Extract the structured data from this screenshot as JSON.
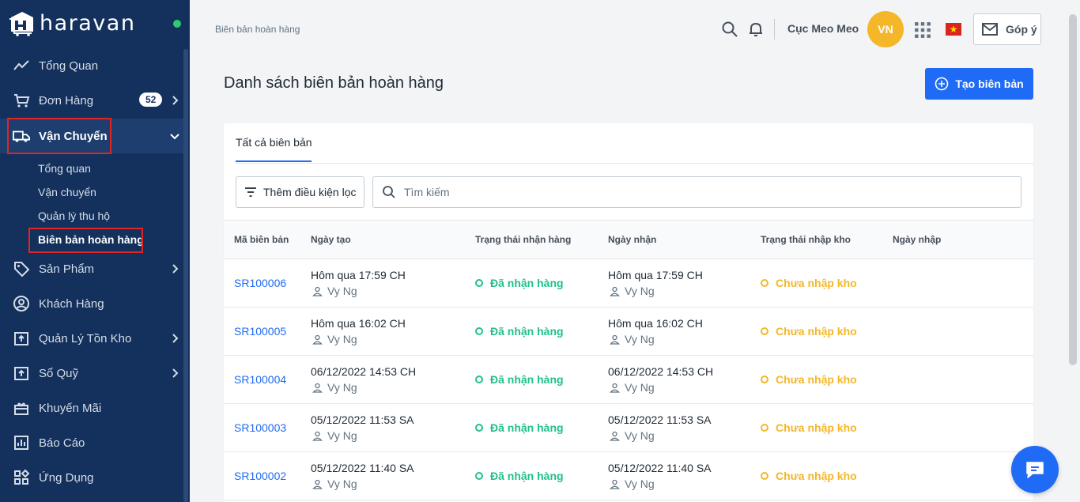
{
  "sidebar": {
    "brand": "haravan",
    "items": [
      {
        "label": "Tổng Quan"
      },
      {
        "label": "Đơn Hàng",
        "badge": "52"
      },
      {
        "label": "Vận Chuyển"
      },
      {
        "label": "Sản Phẩm"
      },
      {
        "label": "Khách Hàng"
      },
      {
        "label": "Quản Lý Tồn Kho"
      },
      {
        "label": "Sổ Quỹ"
      },
      {
        "label": "Khuyến Mãi"
      },
      {
        "label": "Báo Cáo"
      },
      {
        "label": "Ứng Dụng"
      }
    ],
    "sub_items": [
      {
        "label": "Tổng quan"
      },
      {
        "label": "Vận chuyển"
      },
      {
        "label": "Quản lý thu hộ"
      },
      {
        "label": "Biên bản hoàn hàng"
      }
    ]
  },
  "topbar": {
    "breadcrumb": "Biên bản hoàn hàng",
    "shop_name": "Cục Meo Meo",
    "avatar_initials": "VN",
    "feedback_label": "Góp ý"
  },
  "page": {
    "title": "Danh sách biên bản hoàn hàng",
    "create_button": "Tạo biên bản",
    "tab": "Tất cả biên bản",
    "filter_button": "Thêm điều kiện lọc",
    "search_placeholder": "Tìm kiếm"
  },
  "table": {
    "columns": [
      "Mã biên bản",
      "Ngày tạo",
      "Trạng thái nhận hàng",
      "Ngày nhận",
      "Trạng thái nhập kho",
      "Ngày nhập"
    ],
    "rows": [
      {
        "code": "SR100006",
        "created": "Hôm qua 17:59 CH",
        "creator": "Vy Ng",
        "receive_status": "Đã nhận hàng",
        "received": "Hôm qua 17:59 CH",
        "receiver": "Vy Ng",
        "stock_status": "Chưa nhập kho",
        "stocked": ""
      },
      {
        "code": "SR100005",
        "created": "Hôm qua 16:02 CH",
        "creator": "Vy Ng",
        "receive_status": "Đã nhận hàng",
        "received": "Hôm qua 16:02 CH",
        "receiver": "Vy Ng",
        "stock_status": "Chưa nhập kho",
        "stocked": ""
      },
      {
        "code": "SR100004",
        "created": "06/12/2022 14:53 CH",
        "creator": "Vy Ng",
        "receive_status": "Đã nhận hàng",
        "received": "06/12/2022 14:53 CH",
        "receiver": "Vy Ng",
        "stock_status": "Chưa nhập kho",
        "stocked": ""
      },
      {
        "code": "SR100003",
        "created": "05/12/2022 11:53 SA",
        "creator": "Vy Ng",
        "receive_status": "Đã nhận hàng",
        "received": "05/12/2022 11:53 SA",
        "receiver": "Vy Ng",
        "stock_status": "Chưa nhập kho",
        "stocked": ""
      },
      {
        "code": "SR100002",
        "created": "05/12/2022 11:40 SA",
        "creator": "Vy Ng",
        "receive_status": "Đã nhận hàng",
        "received": "05/12/2022 11:40 SA",
        "receiver": "Vy Ng",
        "stock_status": "Chưa nhập kho",
        "stocked": ""
      }
    ]
  },
  "colors": {
    "sidebar_bg": "#13315c",
    "accent": "#1f6bf5",
    "received_green": "#22c08a",
    "pending_orange": "#f5b72a",
    "avatar": "#f5b72a"
  }
}
